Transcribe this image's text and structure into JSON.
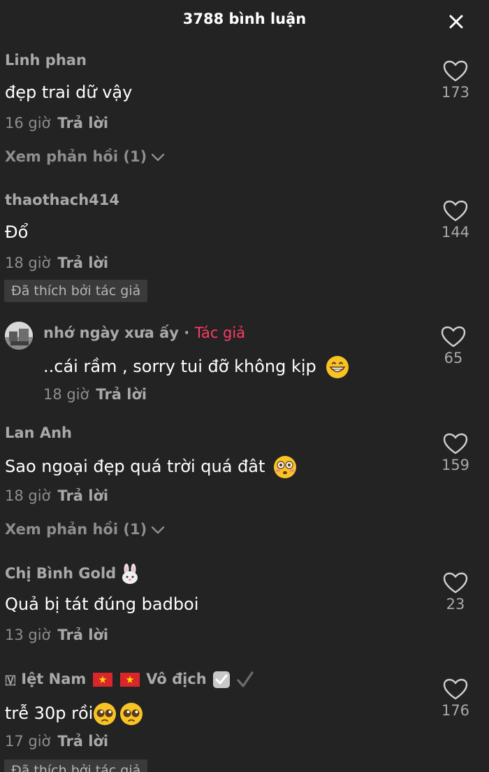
{
  "header": {
    "title": "3788 bình luận"
  },
  "comments": [
    {
      "username": "Linh phan",
      "text": "đẹp trai dữ vậy",
      "time": "16 giờ",
      "reply": "Trả lời",
      "likes": "173",
      "view_replies": "Xem phản hồi (1)"
    },
    {
      "username": "thaothach414",
      "text": "Đổ",
      "time": "18 giờ",
      "reply": "Trả lời",
      "likes": "144",
      "liked_by_author": "Đã thích bởi tác giả"
    },
    {
      "username": "nhớ ngày xưa ấy",
      "separator": "·",
      "author_tag": "Tác giả",
      "text": "..cái rầm , sorry tui đỡ không kịp",
      "emoji": "grinning-face",
      "time": "18 giờ",
      "reply": "Trả lời",
      "likes": "65"
    },
    {
      "username": "Lan Anh",
      "text": "Sao ngoại đẹp quá trời quá đât",
      "emoji": "flushed-face",
      "time": "18 giờ",
      "reply": "Trả lời",
      "likes": "159",
      "view_replies": "Xem phản hồi (1)"
    },
    {
      "username": "Chị Bình Gold",
      "username_emoji": "rabbit-face",
      "text": "Quả bị tát đúng badboi",
      "time": "13 giờ",
      "reply": "Trả lời",
      "likes": "23"
    },
    {
      "username_prefix": "🇻",
      "username_a": "Iệt Nam",
      "username_b": "Vô địch",
      "username_emoji": "check-box-and-check-mark",
      "text": "trễ 30p rồi",
      "emoji": "pleading-face",
      "time": "17 giờ",
      "reply": "Trả lời",
      "likes": "176",
      "liked_by_author": "Đã thích bởi tác giả"
    }
  ],
  "colors": {
    "background": "#232323",
    "author_tag": "#ff3a66",
    "muted": "#8e8e8e",
    "username": "#a9a9a9"
  }
}
